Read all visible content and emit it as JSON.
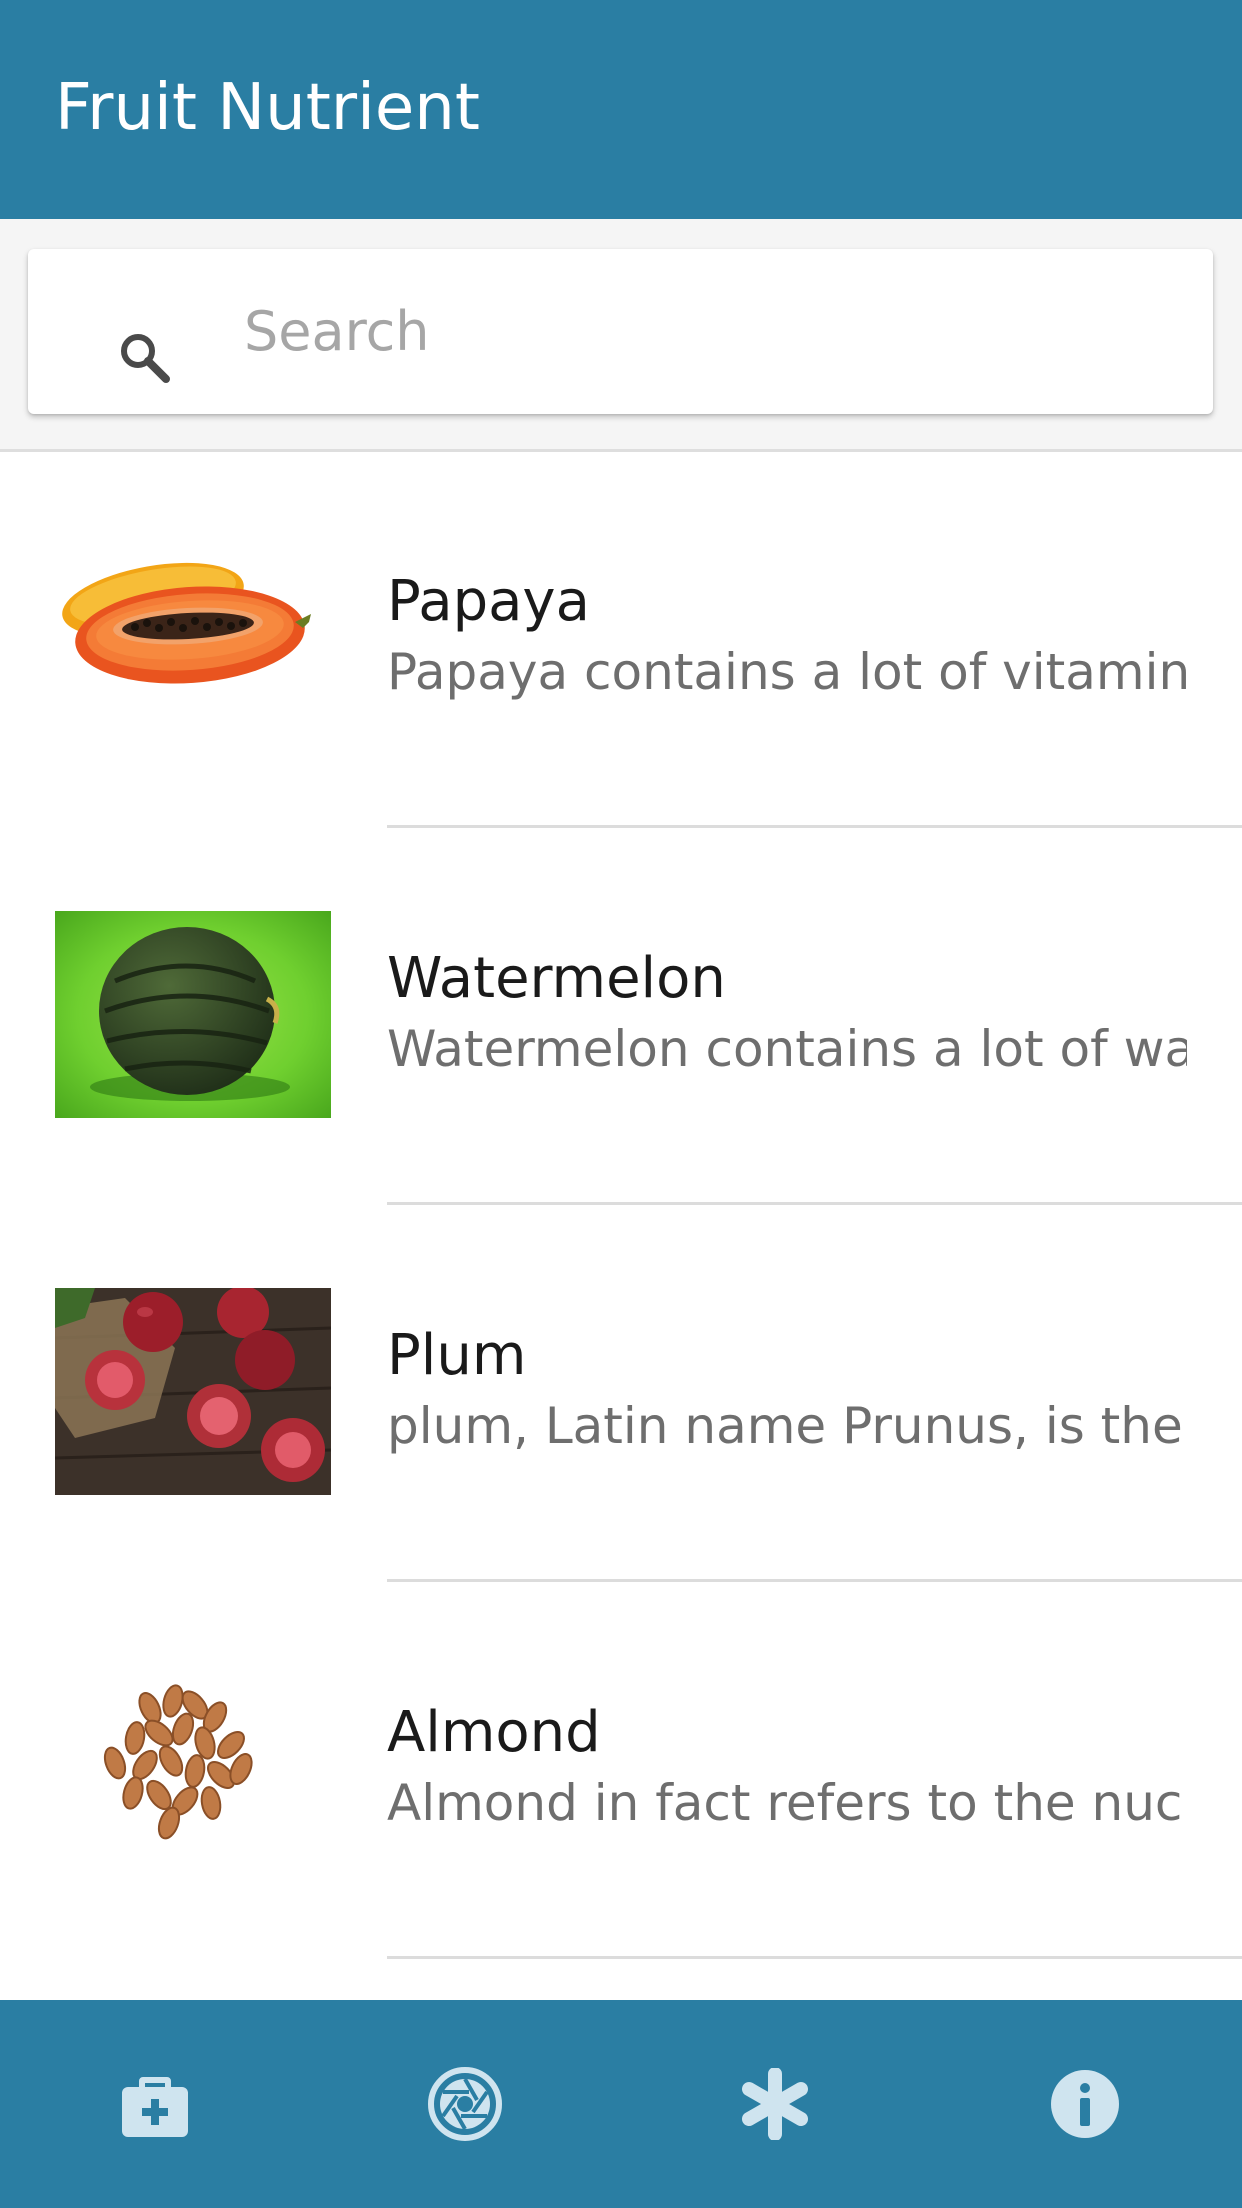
{
  "app_bar": {
    "title": "Fruit Nutrient",
    "color": "#2a7ea3"
  },
  "search": {
    "placeholder": "Search",
    "icon": "search-icon"
  },
  "items": [
    {
      "title": "Papaya",
      "description": "Papaya contains a lot of vitamin A and",
      "image": "papaya-image"
    },
    {
      "title": "Watermelon",
      "description": "Watermelon contains a lot of water, su",
      "image": "watermelon-image"
    },
    {
      "title": "Plum",
      "description": "plum, Latin name Prunus, is the fruit o",
      "image": "plum-image"
    },
    {
      "title": "Almond",
      "description": "Almond in fact refers to the nucleolus",
      "image": "almond-image"
    }
  ],
  "bottom_nav": {
    "tabs": [
      {
        "icon": "medical-kit-icon"
      },
      {
        "icon": "camera-aperture-icon"
      },
      {
        "icon": "asterisk-icon"
      },
      {
        "icon": "info-icon"
      }
    ],
    "icon_color": "#cfe4ef"
  }
}
